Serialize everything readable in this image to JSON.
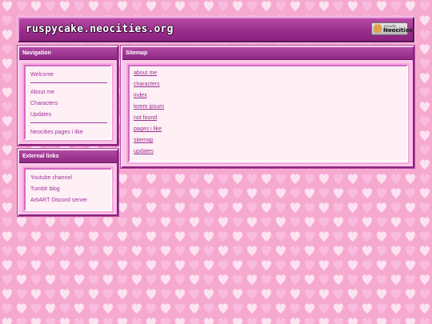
{
  "header": {
    "site_title": "ruspycake.neocities.org",
    "badge_small": "proudly hosted by",
    "badge_big": "Neocities"
  },
  "navigation": {
    "title": "Navigation",
    "groups": [
      [
        "Welcome"
      ],
      [
        "About me",
        "Characters",
        "Updates"
      ],
      [
        "Neocities pages i like"
      ]
    ]
  },
  "external_links": {
    "title": "External links",
    "items": [
      "Youtube channel",
      "Tumblr blog",
      "ArtiART Discord server"
    ]
  },
  "sitemap": {
    "title": "Sitemap",
    "links": [
      "about me",
      "characters",
      "index",
      "lorem ipsum",
      "not found",
      "pages i like",
      "sitemap",
      "updates"
    ]
  },
  "colors": {
    "background": "#f6a9cf",
    "heart": "#fde2f0",
    "header": "#9a2d8c",
    "link": "#a0309a"
  },
  "icons": {
    "badge": "neocities-cat-icon",
    "background": "heart-pattern"
  }
}
